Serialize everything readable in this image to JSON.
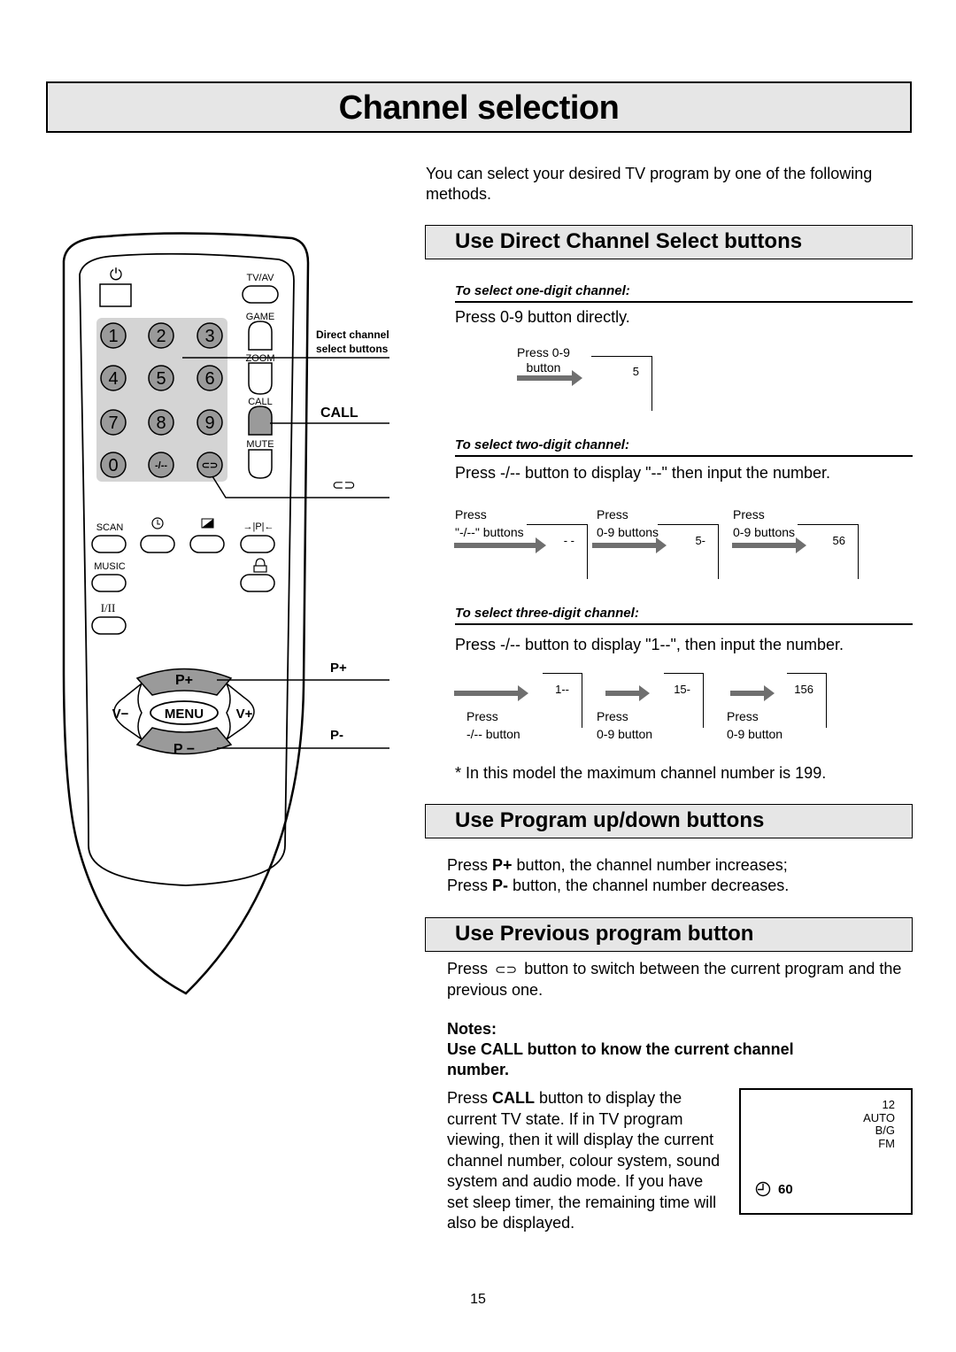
{
  "page": {
    "title": "Channel selection",
    "intro": "You can select your desired TV program by one of the following methods.",
    "page_number": "15"
  },
  "remote": {
    "labels": {
      "tvav": "TV/AV",
      "game": "GAME",
      "zoom": "ZOOM",
      "call": "CALL",
      "mute": "MUTE",
      "scan": "SCAN",
      "music": "MUSIC",
      "dual": "I/II",
      "menu": "MENU",
      "p_plus": "P+",
      "p_minus": "P −",
      "v_minus": "V−",
      "v_plus": "V+"
    },
    "digits": [
      "1",
      "2",
      "3",
      "4",
      "5",
      "6",
      "7",
      "8",
      "9",
      "0",
      "-/--",
      "⊂⊃"
    ],
    "icons": [
      "power-icon",
      "sleep-timer-icon",
      "picture-mode-icon",
      "pip-icon",
      "lock-icon",
      "previous-program-icon"
    ],
    "callouts": {
      "direct": "Direct channel select buttons",
      "call": "CALL",
      "previous": "⊂⊃",
      "p_plus": "P+",
      "p_minus": "P-"
    },
    "colors": {
      "button_gray": "#9a9a9a",
      "keypad_bg": "#d4d4d4"
    }
  },
  "sections": {
    "direct": {
      "heading": "Use Direct Channel Select buttons",
      "one_digit": {
        "subheading": "To select one-digit channel:",
        "text": "Press 0-9 button directly.",
        "steps": [
          {
            "label": "Press 0-9 button",
            "display": "5"
          }
        ]
      },
      "two_digit": {
        "subheading": "To select two-digit channel:",
        "text": "Press -/-- button to display \"--\" then input the number.",
        "steps": [
          {
            "label_line1": "Press",
            "label_line2": "\"-/--\" buttons",
            "display": "- -"
          },
          {
            "label_line1": "Press",
            "label_line2": "0-9 buttons",
            "display": "5-"
          },
          {
            "label_line1": "Press",
            "label_line2": "0-9 buttons",
            "display": "56"
          }
        ]
      },
      "three_digit": {
        "subheading": "To select three-digit channel:",
        "text": "Press -/-- button to display \"1--\", then input the number.",
        "steps": [
          {
            "label_line1": "Press",
            "label_line2": "-/-- button",
            "display": "1--"
          },
          {
            "label_line1": "Press",
            "label_line2": "0-9 button",
            "display": "15-"
          },
          {
            "label_line1": "Press",
            "label_line2": "0-9 button",
            "display": "156"
          }
        ]
      },
      "max_note": "* In this model the maximum channel number is 199."
    },
    "program": {
      "heading": "Use Program up/down buttons",
      "line1_pre": "Press ",
      "line1_bold": "P+",
      "line1_post": " button, the channel number increases;",
      "line2_pre": "Press ",
      "line2_bold": "P-",
      "line2_post": " button, the channel number decreases."
    },
    "previous": {
      "heading": "Use Previous program button",
      "text_pre": "Press",
      "symbol": "⊂⊃",
      "text_post": "button to switch between the current program and the previous one.",
      "notes_label": "Notes:",
      "notes_heading": "Use CALL button to know the current channel number.",
      "call_pre": "Press ",
      "call_bold": "CALL",
      "call_post": " button to display the current TV state. If in TV program viewing, then it will display the current channel number, colour system, sound system and audio mode. If you have set sleep timer, the remaining time will also be displayed."
    }
  },
  "osd": {
    "channel": "12",
    "colour_system": "AUTO",
    "sound_system": "B/G",
    "audio_mode": "FM",
    "sleep_timer": "60"
  },
  "colors": {
    "header_bg": "#e6e6e6",
    "arrow": "#6f6f6f"
  }
}
